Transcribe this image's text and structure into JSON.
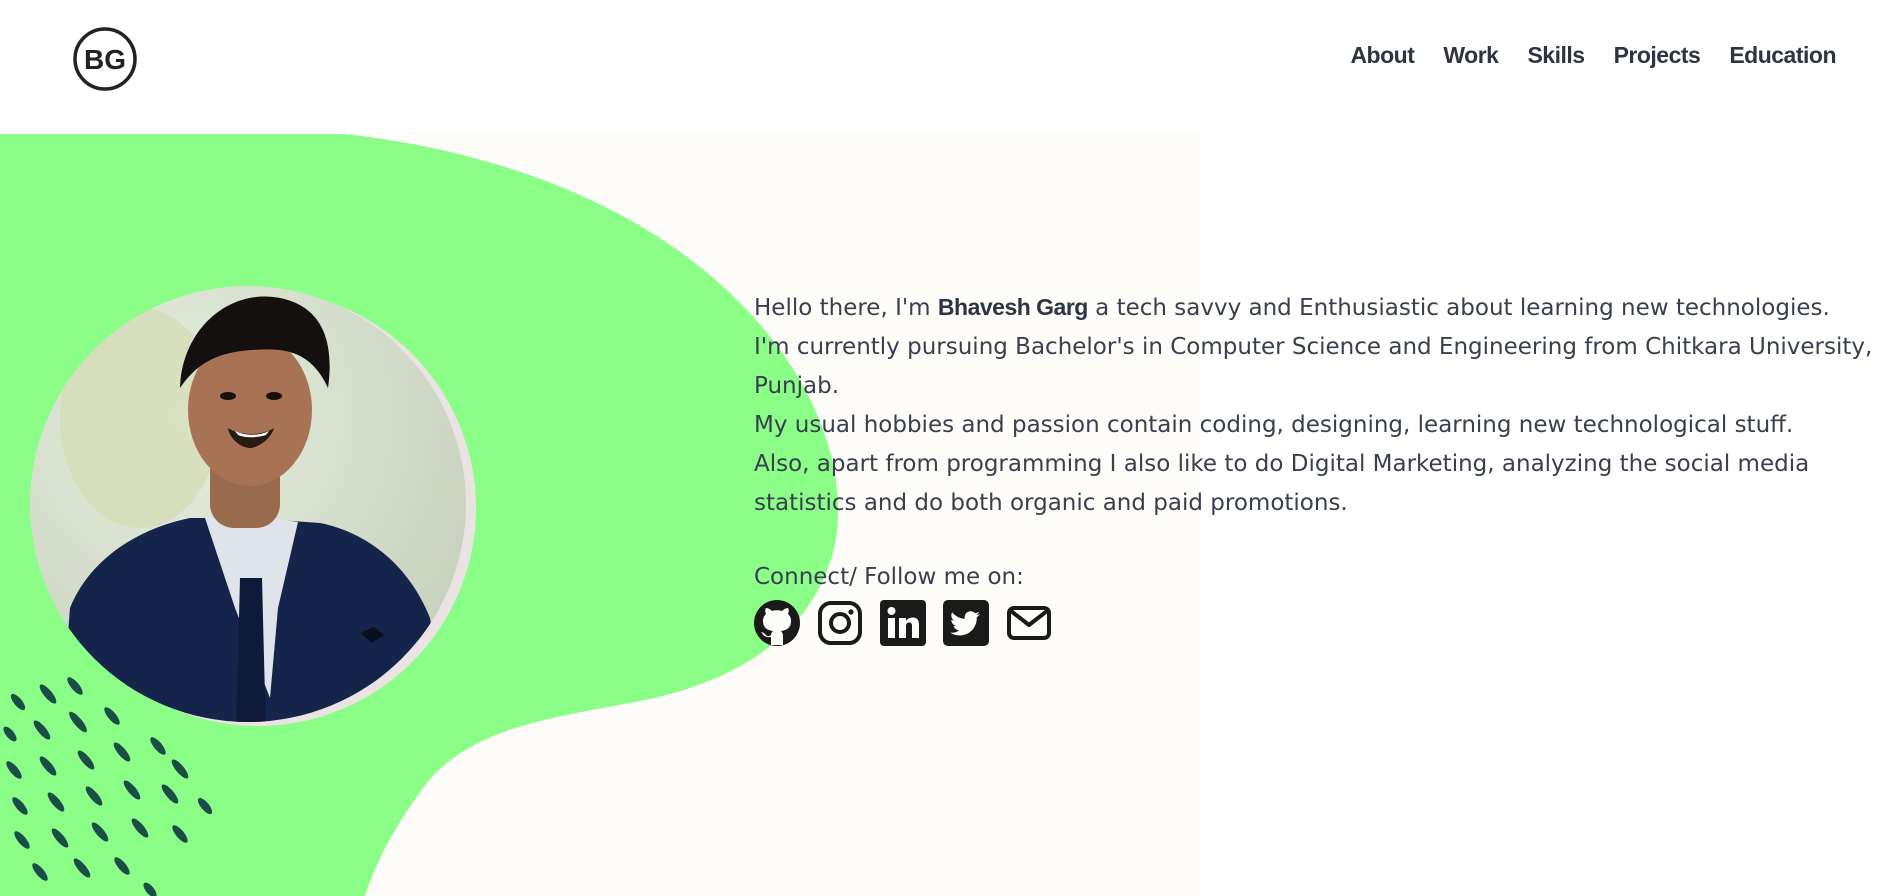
{
  "header": {
    "logo_text": "BG",
    "nav": [
      {
        "label": "About"
      },
      {
        "label": "Work"
      },
      {
        "label": "Skills"
      },
      {
        "label": "Projects"
      },
      {
        "label": "Education"
      }
    ]
  },
  "hero": {
    "bio": {
      "greeting": "Hello there, I'm ",
      "name": "Bhavesh Garg",
      "intro_rest": " a tech savvy and Enthusiastic about learning new technologies.",
      "line_study": "I'm currently pursuing Bachelor's in Computer Science and Engineering from Chitkara University, Punjab.",
      "line_hobbies": "My usual hobbies and passion contain coding, designing, learning new technological stuff.",
      "line_marketing": "Also, apart from programming I also like to do Digital Marketing, analyzing the social media statistics and do both organic and paid promotions."
    },
    "connect_label": "Connect/ Follow me on:",
    "socials": [
      {
        "icon": "github-icon"
      },
      {
        "icon": "instagram-icon"
      },
      {
        "icon": "linkedin-icon"
      },
      {
        "icon": "twitter-icon"
      },
      {
        "icon": "mail-icon"
      }
    ]
  },
  "colors": {
    "blob_green": "#8afe86",
    "cream_bg": "#fdfcf8",
    "dash_pattern": "#1b4d47",
    "text": "#3a3f4f",
    "nav_text": "#2f3445",
    "icon": "#1a1a1a"
  }
}
